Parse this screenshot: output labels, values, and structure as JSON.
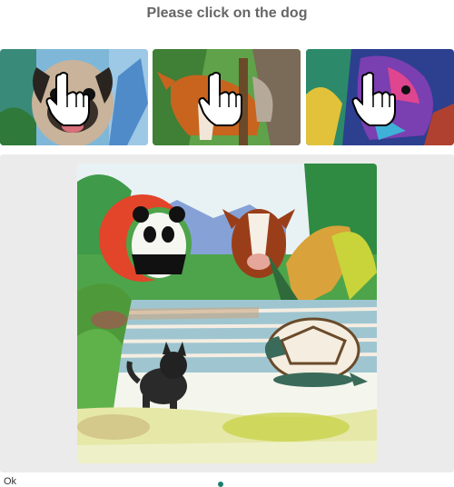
{
  "prompt": "Please click on the dog",
  "examples": [
    {
      "name": "pug",
      "icon": "hand-pointer-icon"
    },
    {
      "name": "fox-dog",
      "icon": "hand-pointer-icon"
    },
    {
      "name": "colorful-dog",
      "icon": "hand-pointer-icon"
    }
  ],
  "scene": {
    "target": "dog"
  },
  "footer": {
    "left_text": "Ok"
  },
  "colors": {
    "panel": "#ebebeb",
    "accent": "#1d7f6d",
    "prompt_text": "#666666"
  }
}
